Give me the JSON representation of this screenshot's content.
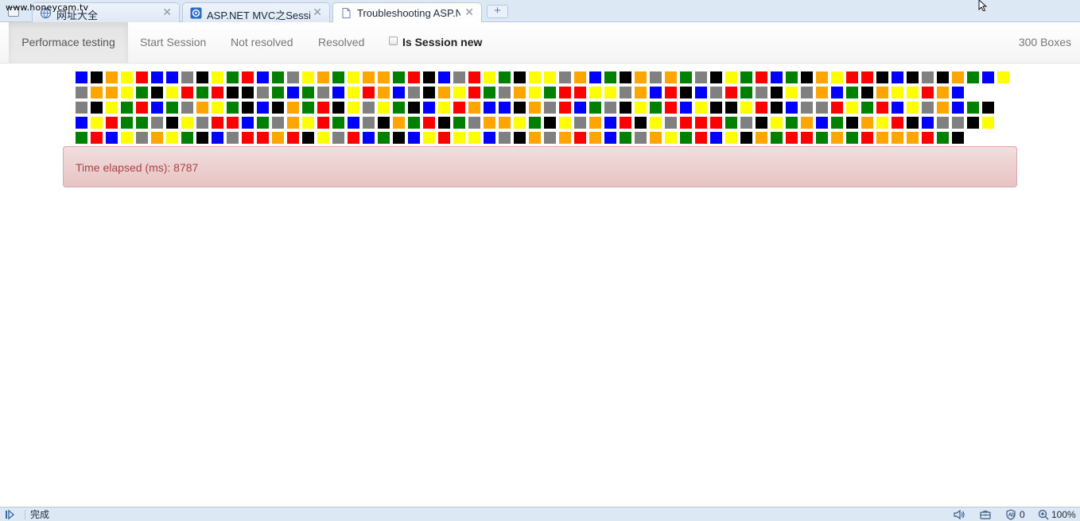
{
  "watermark": "www.honeycam.tv",
  "tabs": [
    {
      "title": "网址大全",
      "close": "✕",
      "active": false
    },
    {
      "title": "ASP.NET MVC之Sessio",
      "close": "✕",
      "active": false
    },
    {
      "title": "Troubleshooting ASP.N",
      "close": "✕",
      "active": true
    }
  ],
  "new_tab_label": "+",
  "navbar": {
    "items": [
      "Performace testing",
      "Start Session",
      "Not resolved",
      "Resolved"
    ],
    "checkbox_label": "Is Session new",
    "checkbox_checked": false,
    "count_label": "300 Boxes"
  },
  "colors": {
    "B": "#0000ff",
    "K": "#000000",
    "O": "#ffa500",
    "Y": "#ffff00",
    "R": "#ff0000",
    "E": "#808080",
    "G": "#008000"
  },
  "box_rows": [
    "BKOYRBBEKYGRBGEYOGYOOGRKBERYGKYYEOBGKOEOGEKYGRBGKOYRRKBKEKOGBY",
    "EOOYGKYRGRKKEGBGEBYROBEKOYRGEOYGRRYYEOBRKBERGEKYEOBGKOYYROB",
    "EKYGRBGEOYGKBKOGRKYEYGKBYROBBKOERBGEKYGRBYKKYRKBEERYGRBYEOBGK",
    "BYRGGEKYERRBGEOYRGBEKOGRKGEOOYGKYEOBRKYERRRGEKYGOBGKOYRKBEEKY",
    "GRBYEOYGKBERRORKYERBGKBYRYYBEKOEOROBGEOYGRBYKOGRRGOGROOORGK"
  ],
  "alert_text": "Time elapsed (ms): 8787",
  "status": {
    "text": "完成",
    "zoom": "100%",
    "counter": "0",
    "icons": [
      "sidebar-toggle-icon",
      "volume-icon",
      "toolbox-icon",
      "ad-block-icon",
      "zoom-icon"
    ]
  }
}
